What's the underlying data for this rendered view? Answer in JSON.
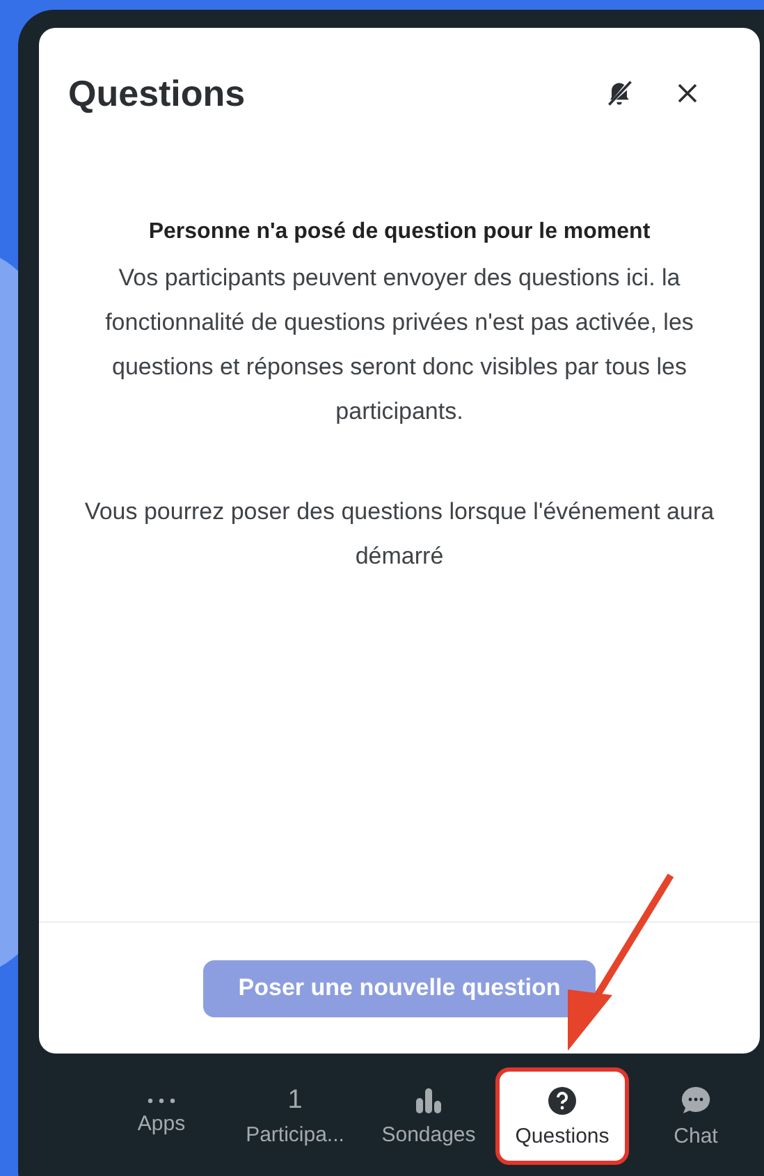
{
  "panel": {
    "title": "Questions",
    "notifications_muted": true
  },
  "empty_state": {
    "heading": "Personne n'a posé de question pour le moment",
    "paragraphs": [
      "Vos participants peuvent envoyer des questions ici. la fonctionnalité de questions privées n'est pas activée, les questions et réponses seront donc visibles par tous les participants.",
      "Vous pourrez poser des questions lorsque l'événement aura démarré"
    ]
  },
  "ask_button": {
    "label": "Poser une nouvelle question",
    "disabled": true
  },
  "toolbar": [
    {
      "kind": "dots",
      "label": "Apps",
      "selected": false
    },
    {
      "kind": "count",
      "count": "1",
      "label": "Participa...",
      "selected": false
    },
    {
      "kind": "poll",
      "label": "Sondages",
      "selected": false
    },
    {
      "kind": "question",
      "label": "Questions",
      "selected": true
    },
    {
      "kind": "chat",
      "label": "Chat",
      "selected": false
    }
  ]
}
